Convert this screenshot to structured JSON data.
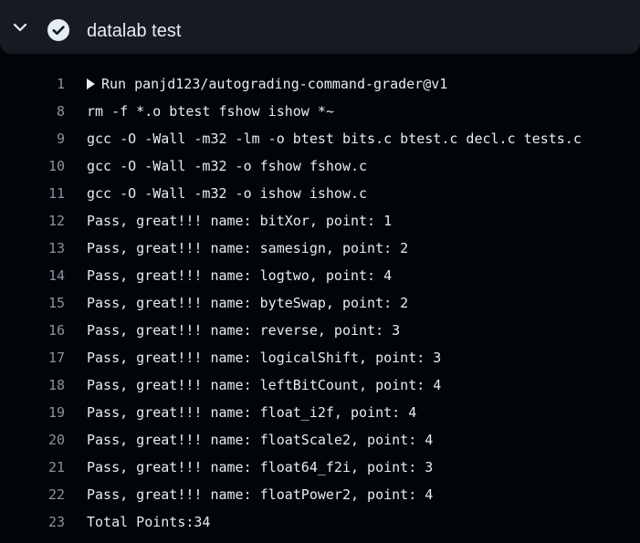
{
  "job": {
    "title": "datalab test",
    "status": "success",
    "expand_icon": "chevron-down-icon",
    "status_icon": "check-circle-icon"
  },
  "colors": {
    "header_bg": "#161b22",
    "page_bg": "#010409",
    "text": "#e6edf3",
    "line_number": "#8b949e"
  },
  "log": {
    "lines": [
      {
        "num": "1",
        "text": "Run panjd123/autograding-command-grader@v1",
        "collapsible": true
      },
      {
        "num": "8",
        "text": "rm -f *.o btest fshow ishow *~"
      },
      {
        "num": "9",
        "text": "gcc -O -Wall -m32 -lm -o btest bits.c btest.c decl.c tests.c"
      },
      {
        "num": "10",
        "text": "gcc -O -Wall -m32 -o fshow fshow.c"
      },
      {
        "num": "11",
        "text": "gcc -O -Wall -m32 -o ishow ishow.c"
      },
      {
        "num": "12",
        "text": "Pass, great!!! name: bitXor, point: 1"
      },
      {
        "num": "13",
        "text": "Pass, great!!! name: samesign, point: 2"
      },
      {
        "num": "14",
        "text": "Pass, great!!! name: logtwo, point: 4"
      },
      {
        "num": "15",
        "text": "Pass, great!!! name: byteSwap, point: 2"
      },
      {
        "num": "16",
        "text": "Pass, great!!! name: reverse, point: 3"
      },
      {
        "num": "17",
        "text": "Pass, great!!! name: logicalShift, point: 3"
      },
      {
        "num": "18",
        "text": "Pass, great!!! name: leftBitCount, point: 4"
      },
      {
        "num": "19",
        "text": "Pass, great!!! name: float_i2f, point: 4"
      },
      {
        "num": "20",
        "text": "Pass, great!!! name: floatScale2, point: 4"
      },
      {
        "num": "21",
        "text": "Pass, great!!! name: float64_f2i, point: 3"
      },
      {
        "num": "22",
        "text": "Pass, great!!! name: floatPower2, point: 4"
      },
      {
        "num": "23",
        "text": "Total Points:34"
      }
    ]
  }
}
